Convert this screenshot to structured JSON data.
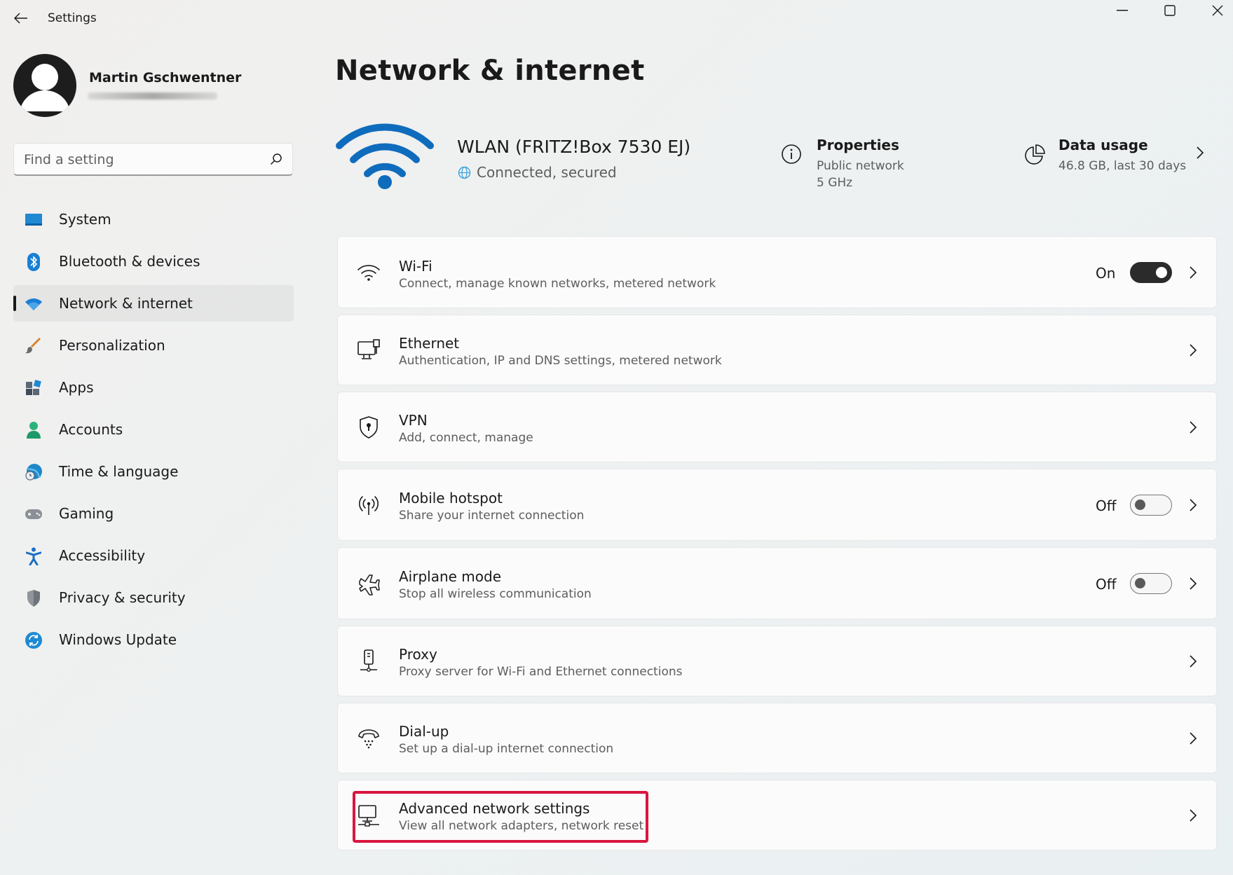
{
  "window": {
    "title": "Settings",
    "back_icon": "arrow-left-icon",
    "controls": [
      "minimize-icon",
      "maximize-icon",
      "close-icon"
    ]
  },
  "user": {
    "name": "Martin Gschwentner"
  },
  "search": {
    "placeholder": "Find a setting",
    "value": ""
  },
  "sidebar": {
    "items": [
      {
        "label": "System",
        "icon": "system-icon",
        "color": "#1f8ad2"
      },
      {
        "label": "Bluetooth & devices",
        "icon": "bluetooth-icon",
        "color": "#1a7fd4"
      },
      {
        "label": "Network & internet",
        "icon": "wifi-icon",
        "color": "#1a7fd4",
        "active": true
      },
      {
        "label": "Personalization",
        "icon": "brush-icon",
        "color": "#e08a2c"
      },
      {
        "label": "Apps",
        "icon": "apps-icon",
        "color": "#4a5a6a"
      },
      {
        "label": "Accounts",
        "icon": "accounts-icon",
        "color": "#2bb27a"
      },
      {
        "label": "Time & language",
        "icon": "globe-clock-icon",
        "color": "#1e88c8"
      },
      {
        "label": "Gaming",
        "icon": "gamepad-icon",
        "color": "#7a7f85"
      },
      {
        "label": "Accessibility",
        "icon": "accessibility-icon",
        "color": "#1a6fc4"
      },
      {
        "label": "Privacy & security",
        "icon": "shield-icon",
        "color": "#8a8f95"
      },
      {
        "label": "Windows Update",
        "icon": "update-icon",
        "color": "#1f8ad2"
      }
    ]
  },
  "main": {
    "title": "Network & internet",
    "connection": {
      "name": "WLAN (FRITZ!Box 7530 EJ)",
      "status": "Connected, secured",
      "accent": "#0f6cbd"
    },
    "properties": {
      "title": "Properties",
      "line1": "Public network",
      "line2": "5 GHz"
    },
    "data_usage": {
      "title": "Data usage",
      "line": "46.8 GB, last 30 days"
    },
    "cards": [
      {
        "title": "Wi-Fi",
        "subtitle": "Connect, manage known networks, metered network",
        "icon": "wifi-icon",
        "toggle": "On"
      },
      {
        "title": "Ethernet",
        "subtitle": "Authentication, IP and DNS settings, metered network",
        "icon": "ethernet-icon"
      },
      {
        "title": "VPN",
        "subtitle": "Add, connect, manage",
        "icon": "vpn-shield-icon"
      },
      {
        "title": "Mobile hotspot",
        "subtitle": "Share your internet connection",
        "icon": "hotspot-icon",
        "toggle": "Off"
      },
      {
        "title": "Airplane mode",
        "subtitle": "Stop all wireless communication",
        "icon": "airplane-icon",
        "toggle": "Off"
      },
      {
        "title": "Proxy",
        "subtitle": "Proxy server for Wi-Fi and Ethernet connections",
        "icon": "proxy-icon"
      },
      {
        "title": "Dial-up",
        "subtitle": "Set up a dial-up internet connection",
        "icon": "dialup-icon"
      },
      {
        "title": "Advanced network settings",
        "subtitle": "View all network adapters, network reset",
        "icon": "network-adapter-icon",
        "highlighted": true
      }
    ],
    "highlight_color": "#d9163f"
  }
}
